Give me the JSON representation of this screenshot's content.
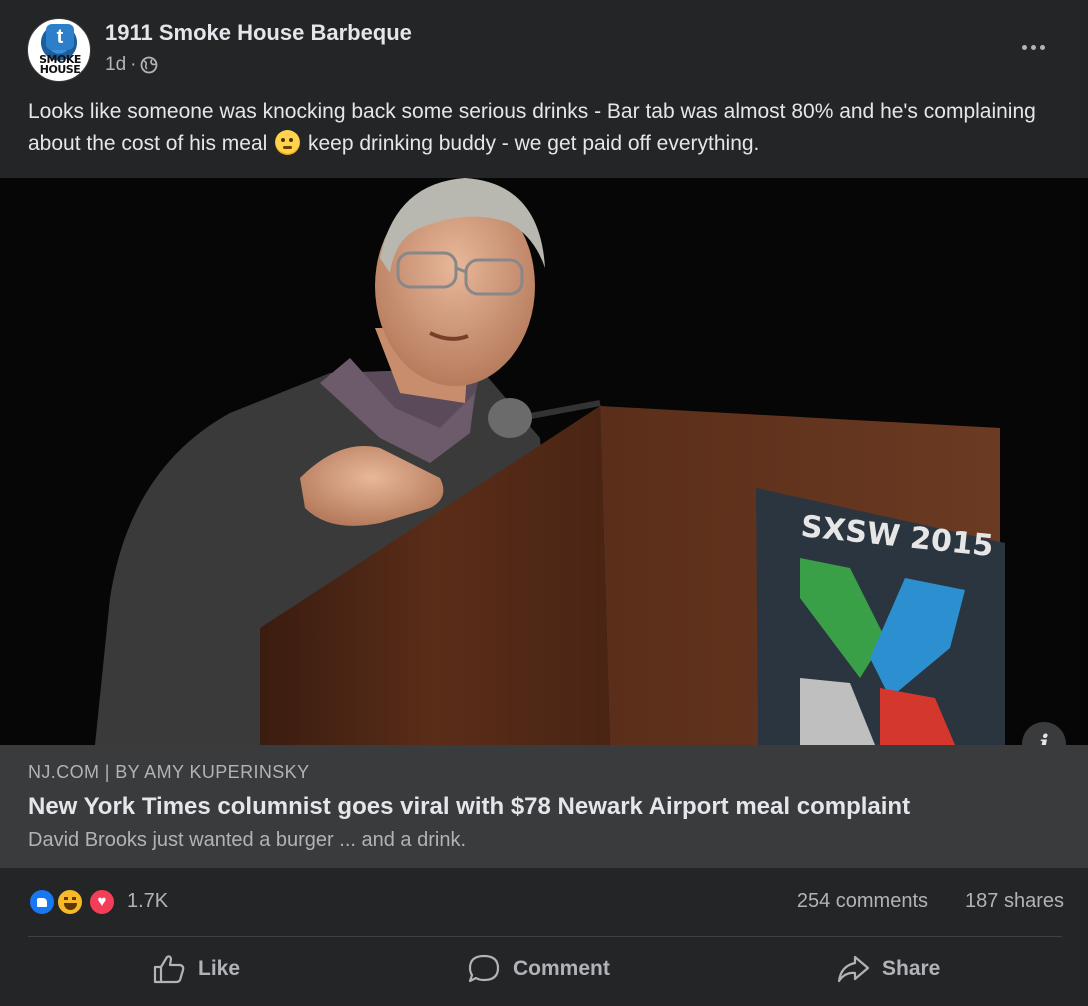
{
  "post": {
    "page_name": "1911 Smoke House Barbeque",
    "avatar_text": "SMOKE HOUSE",
    "avatar_letter": "t",
    "timestamp": "1d",
    "separator": "·",
    "privacy_icon": "globe-icon",
    "more_icon": "more-options-icon",
    "text_part1": "Looks like someone was knocking back some serious drinks - Bar tab was almost 80% and he's complaining about the cost of his meal",
    "text_emoji": "thinking-face-emoji",
    "text_part2": " keep drinking buddy - we get paid off everything."
  },
  "photo": {
    "description_icon": "info-icon",
    "info_label": "i",
    "sign_text": "SXSW 2015"
  },
  "link": {
    "source": "NJ.COM | BY AMY KUPERINSKY",
    "title": "New York Times columnist goes viral with $78 Newark Airport meal complaint",
    "description": "David Brooks just wanted a burger ... and a drink."
  },
  "engagement": {
    "reaction_icons": [
      "like-reaction-icon",
      "haha-reaction-icon",
      "love-reaction-icon"
    ],
    "reaction_count": "1.7K",
    "comments": "254 comments",
    "shares": "187 shares"
  },
  "actions": {
    "like": "Like",
    "comment": "Comment",
    "share": "Share"
  },
  "colors": {
    "card_bg": "#242526",
    "preview_bg": "#3a3b3c",
    "primary_text": "#e4e6eb",
    "secondary_text": "#b0b3b8",
    "like_blue": "#1877f2"
  }
}
